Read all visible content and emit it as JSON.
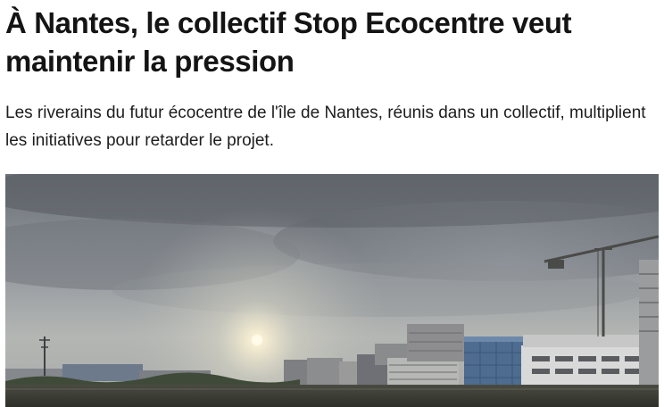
{
  "article": {
    "headline": "À Nantes, le collectif Stop Ecocentre veut maintenir la pression",
    "lede": "Les riverains du futur écocentre de l'île de Nantes, réunis dans un collectif, multiplient les initiatives pour retarder le projet."
  },
  "colors": {
    "headline": "#141414",
    "text": "#1d1d1d",
    "sky": "#9a9fa5",
    "sun": "#fff6d8",
    "buildings": "#8b8e92",
    "glass_building": "#4a6a8f",
    "ground": "#3c3d35"
  }
}
